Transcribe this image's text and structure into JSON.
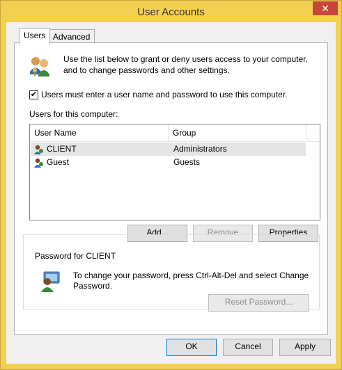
{
  "window": {
    "title": "User Accounts",
    "close_symbol": "✕"
  },
  "tabs": [
    {
      "label": "Users",
      "active": true
    },
    {
      "label": "Advanced",
      "active": false
    }
  ],
  "intro_text_line1": "Use the list below to grant or deny users access to your computer,",
  "intro_text_line2": "and to change passwords and other settings.",
  "require_login": {
    "checked": true,
    "label": "Users must enter a user name and password to use this computer."
  },
  "users_section_label": "Users for this computer:",
  "table": {
    "columns": [
      "User Name",
      "Group"
    ],
    "rows": [
      {
        "name": "CLIENT",
        "group": "Administrators",
        "selected": true
      },
      {
        "name": "Guest",
        "group": "Guests",
        "selected": false
      }
    ]
  },
  "list_buttons": {
    "add": "Add...",
    "remove": "Remove",
    "properties": "Properties"
  },
  "password_group": {
    "title": "Password for CLIENT",
    "text_line1": "To change your password, press Ctrl-Alt-Del and select Change",
    "text_line2": "Password.",
    "reset_button": "Reset Password..."
  },
  "dialog_buttons": {
    "ok": "OK",
    "cancel": "Cancel",
    "apply": "Apply"
  }
}
